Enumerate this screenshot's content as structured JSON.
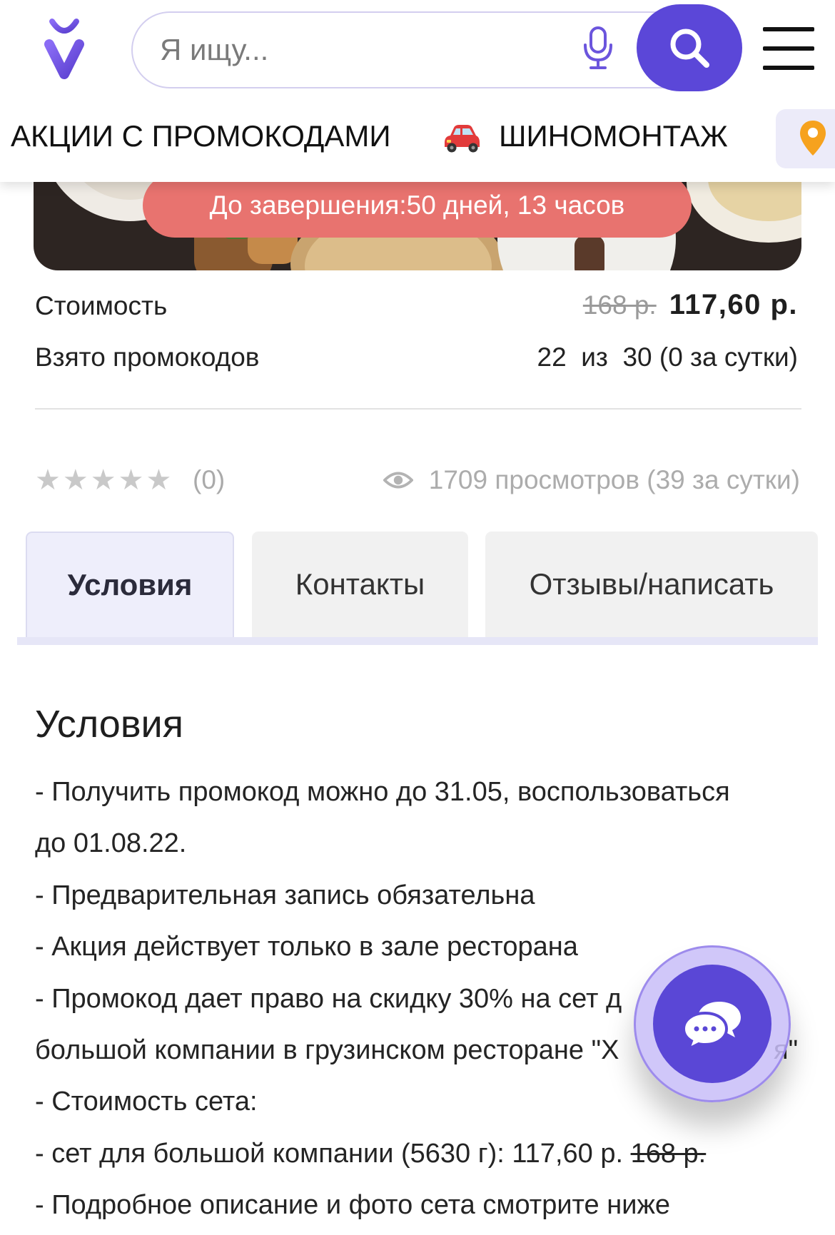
{
  "header": {
    "search": {
      "placeholder": "Я ищу..."
    }
  },
  "nav": {
    "items": [
      {
        "label": "АКЦИИ С ПРОМОКОДАМИ"
      },
      {
        "label": "ШИНОМОНТАЖ",
        "icon": "car-icon"
      }
    ],
    "location_icon": "location-pin-icon"
  },
  "promo": {
    "timer": "До завершения:50 дней, 13 часов"
  },
  "price": {
    "label": "Стоимость",
    "old": "168 р.",
    "new": "117,60 р."
  },
  "taken": {
    "label": "Взято промокодов",
    "value": "22  из  30 (0 за сутки)"
  },
  "rating": {
    "stars": "★★★★★",
    "value": 0,
    "count": "(0)"
  },
  "views": {
    "text": "1709 просмотров (39 за сутки)",
    "icon": "eye-icon"
  },
  "tabs": [
    {
      "label": "Условия",
      "active": true
    },
    {
      "label": "Контакты",
      "active": false
    },
    {
      "label": "Отзывы/написать",
      "active": false
    }
  ],
  "conditions": {
    "title": "Условия",
    "items": [
      {
        "text": "- Получить промокод можно до 31.05, воспользоваться\nдо 01.08.22."
      },
      {
        "text": "- Предварительная запись обязательна"
      },
      {
        "text": "- Акция действует только в зале ресторана"
      },
      {
        "text": "- Промокод дает право на скидку 30% на сет д\nбольшой компании в грузинском ресторане \"Х",
        "text_after_overlay": "я\""
      },
      {
        "text": "- Стоимость сета:"
      },
      {
        "text": "- сет для большой компании (5630 г): 117,60 р. ",
        "old_price": "168 р."
      },
      {
        "text": "- Подробное описание и фото сета смотрите ниже"
      }
    ]
  },
  "icons": {
    "logo": "logo-icon",
    "mic": "microphone-icon",
    "search": "search-icon",
    "menu": "hamburger-menu-icon",
    "car": "car-icon",
    "pin": "location-pin-icon",
    "eye": "eye-icon",
    "stars": "star-icon",
    "chat": "chat-bubbles-icon"
  },
  "colors": {
    "accent": "#5b47d8",
    "timer_bg": "#e8736f",
    "pin": "#f6a21e",
    "tab_active_bg": "#eeeefb",
    "tab_bg": "#f1f1f1",
    "muted_text": "#acacac"
  }
}
